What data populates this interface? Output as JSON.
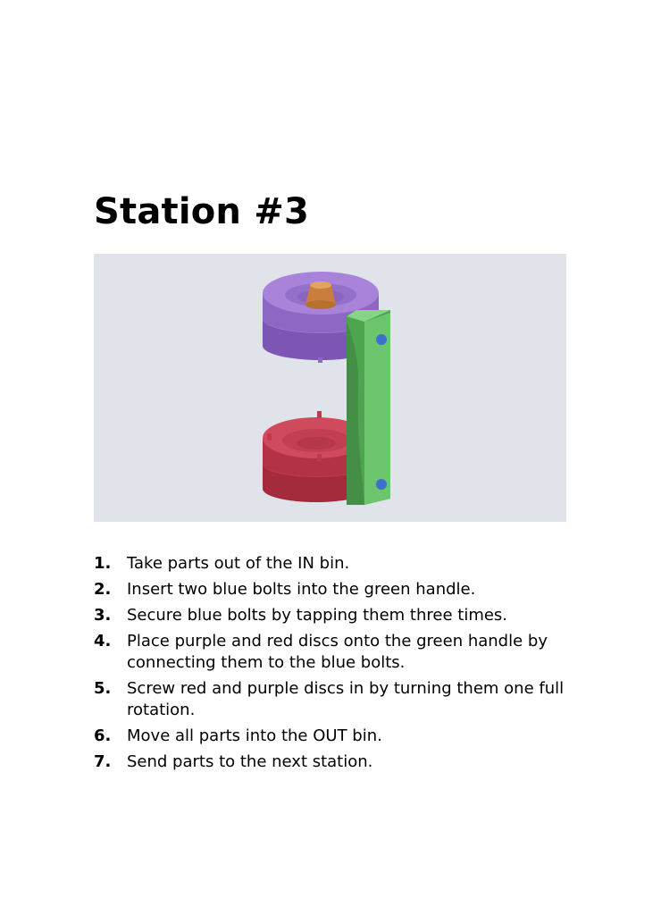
{
  "title": "Station #3",
  "figure": {
    "colors": {
      "background": "#e1e3ea",
      "purple_disc": "#9a72cf",
      "red_disc": "#c2394c",
      "green_handle": "#6cc46c",
      "blue_bolt": "#3d6fcf",
      "peg": "#d4904f"
    }
  },
  "steps": [
    {
      "num": "1.",
      "text": "Take parts out of the IN bin."
    },
    {
      "num": "2.",
      "text": "Insert two blue bolts into the green handle."
    },
    {
      "num": "3.",
      "text": "Secure blue bolts by tapping them three times."
    },
    {
      "num": "4.",
      "text": "Place purple and red discs onto the green handle by connecting them to the blue bolts."
    },
    {
      "num": "5.",
      "text": "Screw red and purple discs in by turning them one full rotation."
    },
    {
      "num": "6.",
      "text": "Move all parts into the OUT bin."
    },
    {
      "num": "7.",
      "text": "Send parts to the next station."
    }
  ]
}
